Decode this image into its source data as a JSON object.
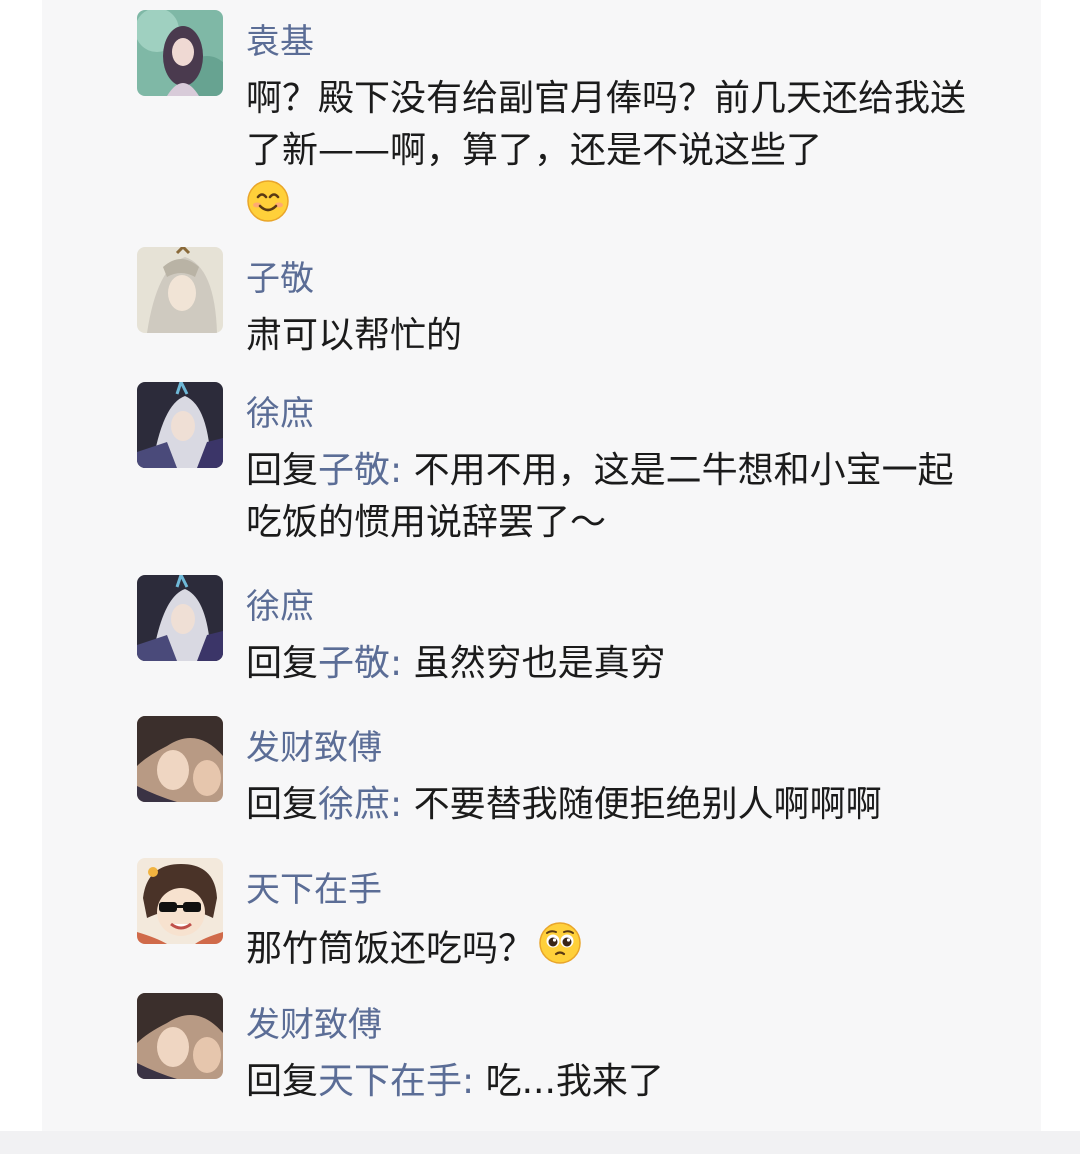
{
  "comments": [
    {
      "name": "袁基",
      "text": "啊？殿下没有给副官月俸吗？前几天还给我送了新——啊，算了，还是不说这些了",
      "emoji": "smiling-face-emoji"
    },
    {
      "name": "子敬",
      "text": "肃可以帮忙的"
    },
    {
      "name": "徐庶",
      "reply_prefix": "回复",
      "reply_target": "子敬:",
      "text": " 不用不用，这是二牛想和小宝一起吃饭的惯用说辞罢了～"
    },
    {
      "name": "徐庶",
      "reply_prefix": "回复",
      "reply_target": "子敬:",
      "text": " 虽然穷也是真穷"
    },
    {
      "name": "发财致傅",
      "reply_prefix": "回复",
      "reply_target": "徐庶:",
      "text": " 不要替我随便拒绝别人啊啊啊"
    },
    {
      "name": "天下在手",
      "text": "那竹筒饭还吃吗？",
      "emoji": "pleading-face-emoji"
    },
    {
      "name": "发财致傅",
      "reply_prefix": "回复",
      "reply_target": "天下在手:",
      "text": " 吃...我来了"
    }
  ],
  "colors": {
    "name": "#5b6d96",
    "text": "#1b1b1b",
    "card_background": "#f7f7f8"
  }
}
